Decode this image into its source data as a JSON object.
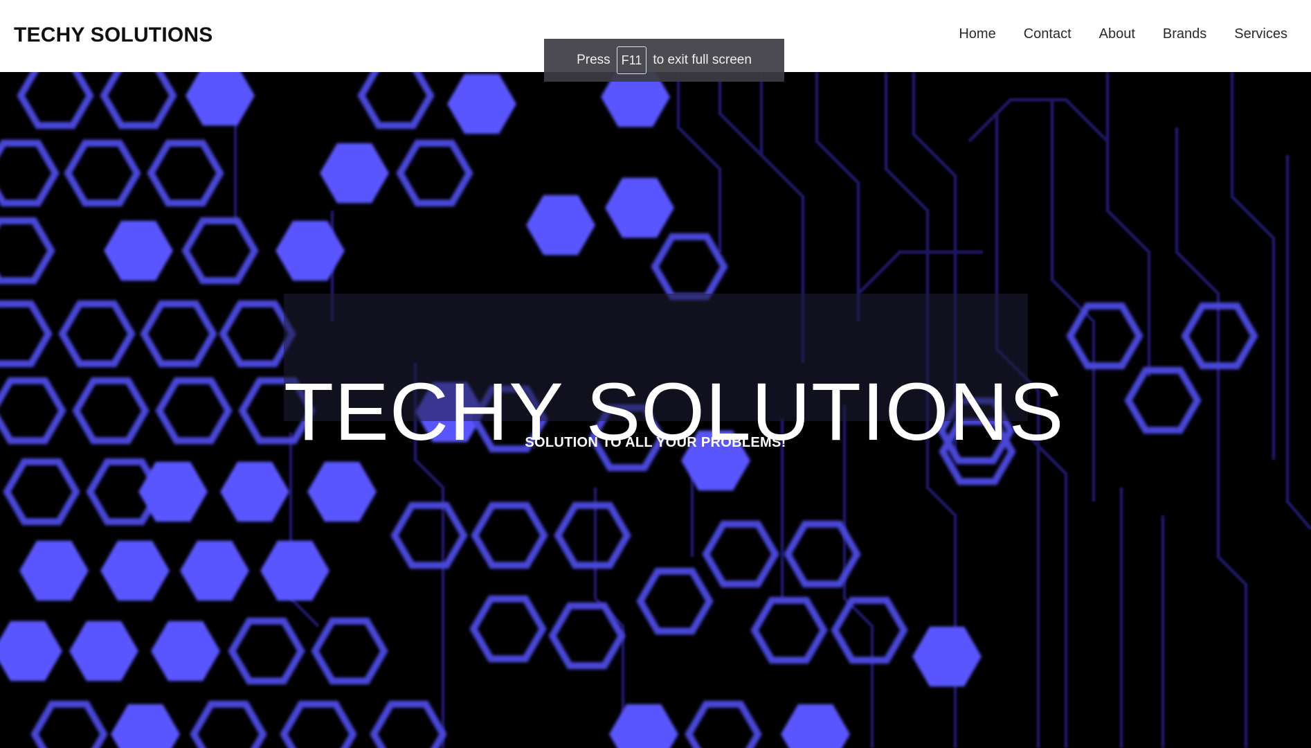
{
  "header": {
    "brand": "TECHY SOLUTIONS",
    "nav": [
      "Home",
      "Contact",
      "About",
      "Brands",
      "Services"
    ]
  },
  "hero": {
    "title": "TECHY SOLUTIONS",
    "subtitle": "SOLUTION TO ALL YOUR PROBLEMS!",
    "background": "blurred-hexagon-circuit-pattern"
  },
  "fullscreen_toast": {
    "prefix": "Press",
    "key": "F11",
    "suffix": "to exit full screen"
  },
  "colors": {
    "header_bg": "#ffffff",
    "hero_bg": "#000000",
    "hex_fill": "#5a56ff",
    "hex_outline": "#4a46d8",
    "circuit_line": "#1a1860",
    "toast_bg": "#3c3c42"
  }
}
